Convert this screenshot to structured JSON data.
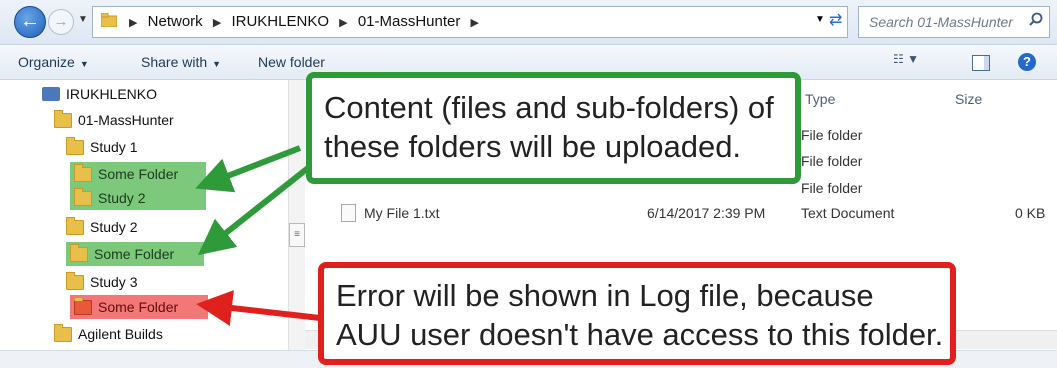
{
  "address": {
    "crumbs": [
      "Network",
      "IRUKHLENKO",
      "01-MassHunter"
    ],
    "search_placeholder": "Search 01-MassHunter"
  },
  "toolbar": {
    "organize": "Organize",
    "share_with": "Share with",
    "new_folder": "New folder"
  },
  "tree": {
    "computer": "IRUKHLENKO",
    "root": "01-MassHunter",
    "study1": "Study 1",
    "study1_some": "Some Folder",
    "study1_study2": "Study 2",
    "study2": "Study 2",
    "study2_some": "Some Folder",
    "study3": "Study 3",
    "study3_some": "Some Folder",
    "agilent": "Agilent Builds"
  },
  "files": {
    "col_type": "Type",
    "col_size": "Size",
    "folder_type": "File folder",
    "file_name": "My File 1.txt",
    "file_date": "6/14/2017 2:39 PM",
    "file_type": "Text Document",
    "file_size": "0 KB"
  },
  "callouts": {
    "green_line1": "Content (files and sub-folders) of",
    "green_line2": "these folders will be uploaded.",
    "red_line1": "Error will be shown in Log file, because",
    "red_line2": "AUU user doesn't have access to this folder."
  },
  "colors": {
    "green_highlight": "#7cc97c",
    "red_highlight": "#f47777",
    "green_callout": "#2f9a3a",
    "red_callout": "#e0201c"
  }
}
